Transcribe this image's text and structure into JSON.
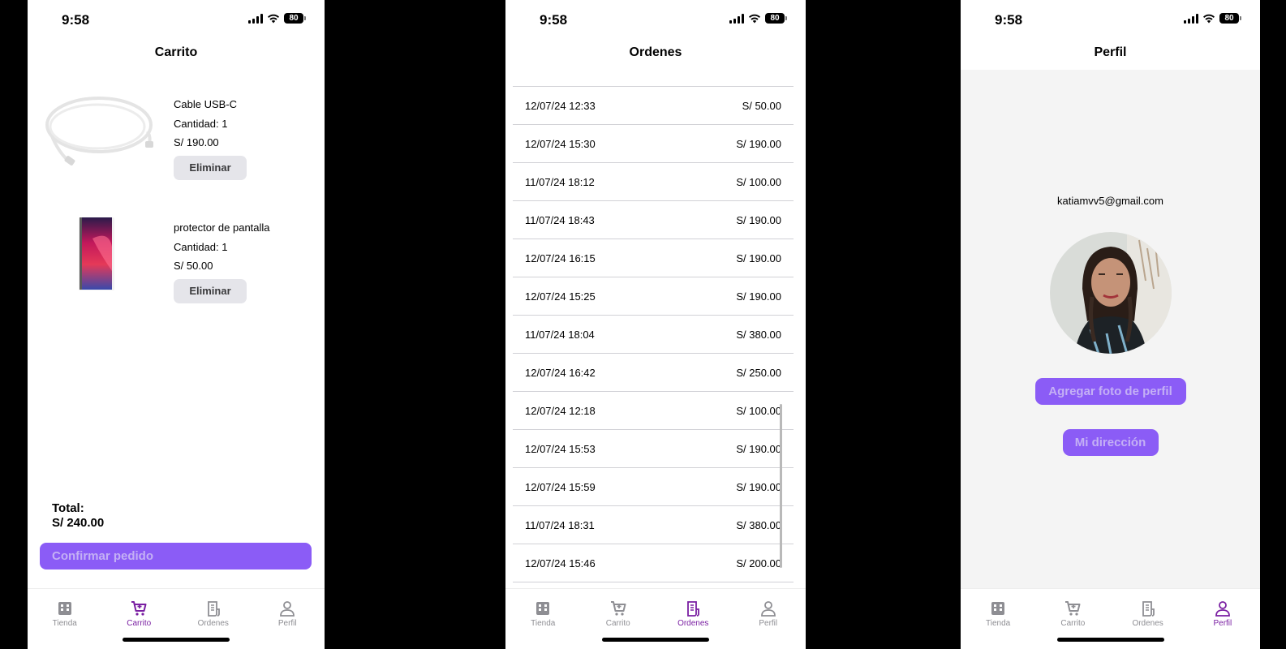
{
  "status": {
    "time": "9:58",
    "battery": "80"
  },
  "tabs": [
    {
      "label": "Tienda",
      "icon": "store-icon"
    },
    {
      "label": "Carrito",
      "icon": "cart-icon"
    },
    {
      "label": "Ordenes",
      "icon": "receipt-icon"
    },
    {
      "label": "Perfil",
      "icon": "person-icon"
    }
  ],
  "accent": "#7a1fa2",
  "cart": {
    "title": "Carrito",
    "items": [
      {
        "name": "Cable USB-C",
        "quantity": "Cantidad: 1",
        "price": "S/ 190.00",
        "remove": "Eliminar",
        "image": "usb-c-cable"
      },
      {
        "name": "protector de pantalla",
        "quantity": "Cantidad: 1",
        "price": "S/ 50.00",
        "remove": "Eliminar",
        "image": "screen-protector"
      }
    ],
    "total_label": "Total:",
    "total_value": "S/ 240.00",
    "confirm": "Confirmar pedido"
  },
  "orders": {
    "title": "Ordenes",
    "rows": [
      {
        "date": "12/07/24 12:33",
        "amount": "S/ 50.00"
      },
      {
        "date": "12/07/24 15:30",
        "amount": "S/ 190.00"
      },
      {
        "date": "11/07/24 18:12",
        "amount": "S/ 100.00"
      },
      {
        "date": "11/07/24 18:43",
        "amount": "S/ 190.00"
      },
      {
        "date": "12/07/24 16:15",
        "amount": "S/ 190.00"
      },
      {
        "date": "12/07/24 15:25",
        "amount": "S/ 190.00"
      },
      {
        "date": "11/07/24 18:04",
        "amount": "S/ 380.00"
      },
      {
        "date": "12/07/24 16:42",
        "amount": "S/ 250.00"
      },
      {
        "date": "12/07/24 12:18",
        "amount": "S/ 100.00"
      },
      {
        "date": "12/07/24 15:53",
        "amount": "S/ 190.00"
      },
      {
        "date": "12/07/24 15:59",
        "amount": "S/ 190.00"
      },
      {
        "date": "11/07/24 18:31",
        "amount": "S/ 380.00"
      },
      {
        "date": "12/07/24 15:46",
        "amount": "S/ 200.00"
      }
    ]
  },
  "profile": {
    "title": "Perfil",
    "email": "katiamvv5@gmail.com",
    "add_photo": "Agregar foto de perfil",
    "address": "Mi dirección"
  }
}
